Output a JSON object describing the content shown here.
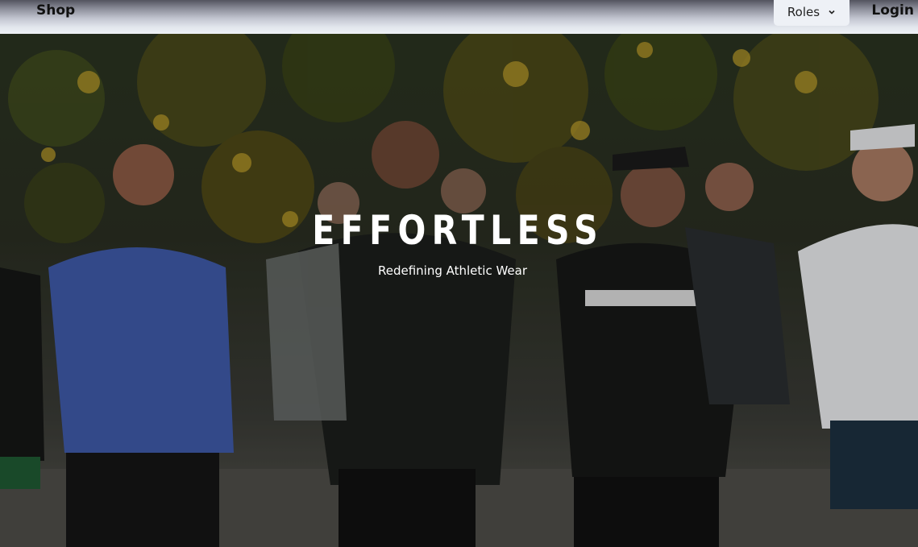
{
  "nav": {
    "brand": "Shop",
    "roles_label": "Roles",
    "login_label": "Login"
  },
  "hero": {
    "title": "EFFORTLESS",
    "subtitle": "Redefining Athletic Wear",
    "image_icon": "runners-photo"
  },
  "colors": {
    "nav_top": "#52535e",
    "nav_bottom": "#eef1f5",
    "hero_text": "#ffffff",
    "foliage": "#b99a2a"
  }
}
